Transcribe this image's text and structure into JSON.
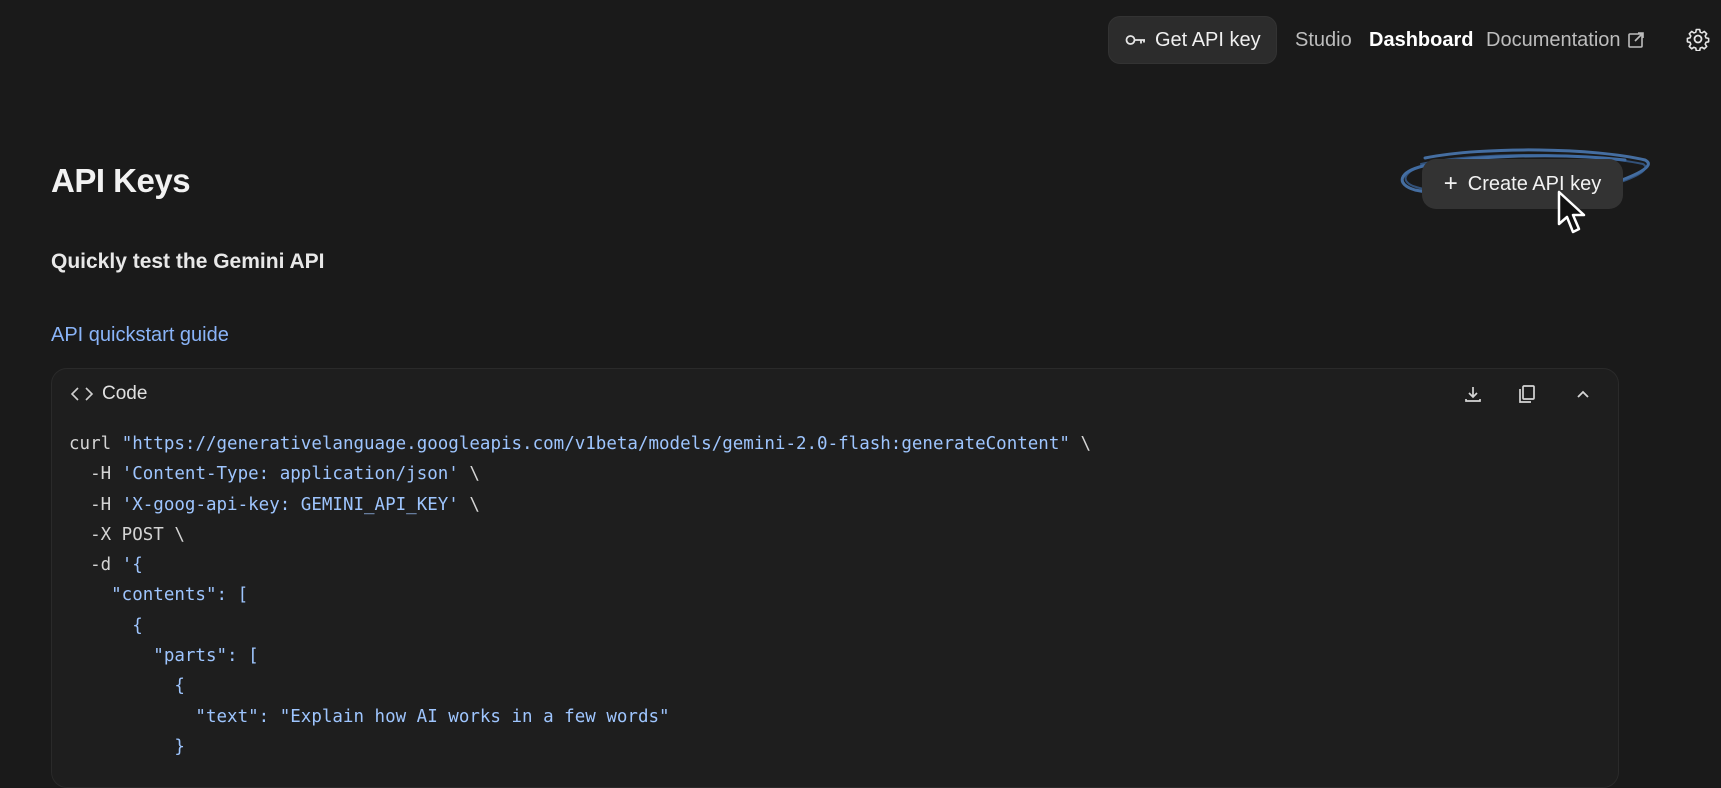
{
  "nav": {
    "get_api_key": "Get API key",
    "studio": "Studio",
    "dashboard": "Dashboard",
    "documentation": "Documentation"
  },
  "page": {
    "title": "API Keys",
    "create_button": "Create API key",
    "subtitle": "Quickly test the Gemini API",
    "quickstart_link": "API quickstart guide"
  },
  "code": {
    "header": "Code",
    "lines": [
      [
        {
          "t": "curl ",
          "c": "p"
        },
        {
          "t": "\"https://generativelanguage.googleapis.com/v1beta/models/gemini-2.0-flash:generateContent\"",
          "c": "s"
        },
        {
          "t": " \\",
          "c": "p"
        }
      ],
      [
        {
          "t": "  -H ",
          "c": "p"
        },
        {
          "t": "'Content-Type: application/json'",
          "c": "s"
        },
        {
          "t": " \\",
          "c": "p"
        }
      ],
      [
        {
          "t": "  -H ",
          "c": "p"
        },
        {
          "t": "'X-goog-api-key: GEMINI_API_KEY'",
          "c": "s"
        },
        {
          "t": " \\",
          "c": "p"
        }
      ],
      [
        {
          "t": "  -X POST \\",
          "c": "p"
        }
      ],
      [
        {
          "t": "  -d ",
          "c": "p"
        },
        {
          "t": "'{",
          "c": "s"
        }
      ],
      [
        {
          "t": "    \"contents\": [",
          "c": "s"
        }
      ],
      [
        {
          "t": "      {",
          "c": "s"
        }
      ],
      [
        {
          "t": "        \"parts\": [",
          "c": "s"
        }
      ],
      [
        {
          "t": "          {",
          "c": "s"
        }
      ],
      [
        {
          "t": "            \"text\": \"Explain how AI works in a few words\"",
          "c": "s"
        }
      ],
      [
        {
          "t": "          }",
          "c": "s"
        }
      ]
    ]
  },
  "colors": {
    "background": "#1a1a1a",
    "link": "#8ab4f8",
    "string": "#9ec5fe",
    "annotation": "#4a78b0"
  },
  "icons": [
    "key-icon",
    "external-link-icon",
    "settings-gear-icon",
    "code-brackets-icon",
    "download-icon",
    "copy-icon",
    "chevron-up-icon",
    "plus-icon",
    "mouse-cursor-icon"
  ]
}
